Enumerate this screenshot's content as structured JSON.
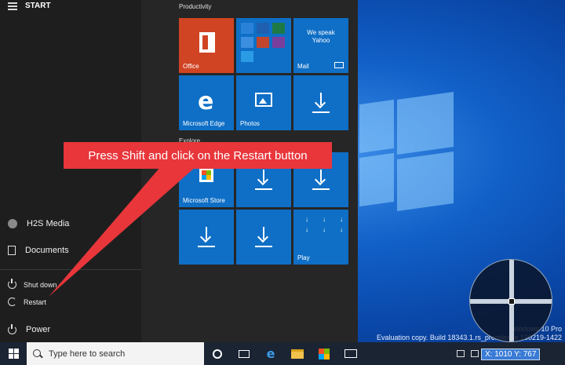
{
  "start_menu": {
    "title": "START",
    "left_items": [
      {
        "label": "H2S Media"
      },
      {
        "label": "Documents"
      },
      {
        "label": "Shut down"
      },
      {
        "label": "Restart"
      },
      {
        "label": "Power"
      }
    ],
    "groups": [
      "Productivity",
      "Explore"
    ],
    "tiles": {
      "office": "Office",
      "mail_text": "We speak Yahoo",
      "mail": "Mail",
      "edge": "Microsoft Edge",
      "photos": "Photos",
      "store": "Microsoft Store",
      "play": "Play"
    }
  },
  "callout": {
    "text": "Press Shift and click on the Restart button"
  },
  "desktop": {
    "watermark_line1": "Windows 10 Pro",
    "watermark_line2": "Evaluation copy. Build 18343.1.rs_prerelease.190219-1422"
  },
  "overlay": {
    "coords": "X: 1010 Y: 767"
  },
  "taskbar": {
    "search_placeholder": "Type here to search"
  },
  "colors": {
    "accent": "#0f6fc6",
    "callout": "#e8363b",
    "office": "#d04423",
    "taskbar": "#1b2433"
  },
  "icons": [
    "hamburger-icon",
    "avatar-icon",
    "document-icon",
    "power-icon",
    "restart-icon",
    "office-icon",
    "edge-icon",
    "photos-icon",
    "mail-icon",
    "store-icon",
    "download-icon",
    "windows-icon",
    "search-icon",
    "cortana-icon",
    "task-view-icon",
    "file-explorer-icon"
  ]
}
